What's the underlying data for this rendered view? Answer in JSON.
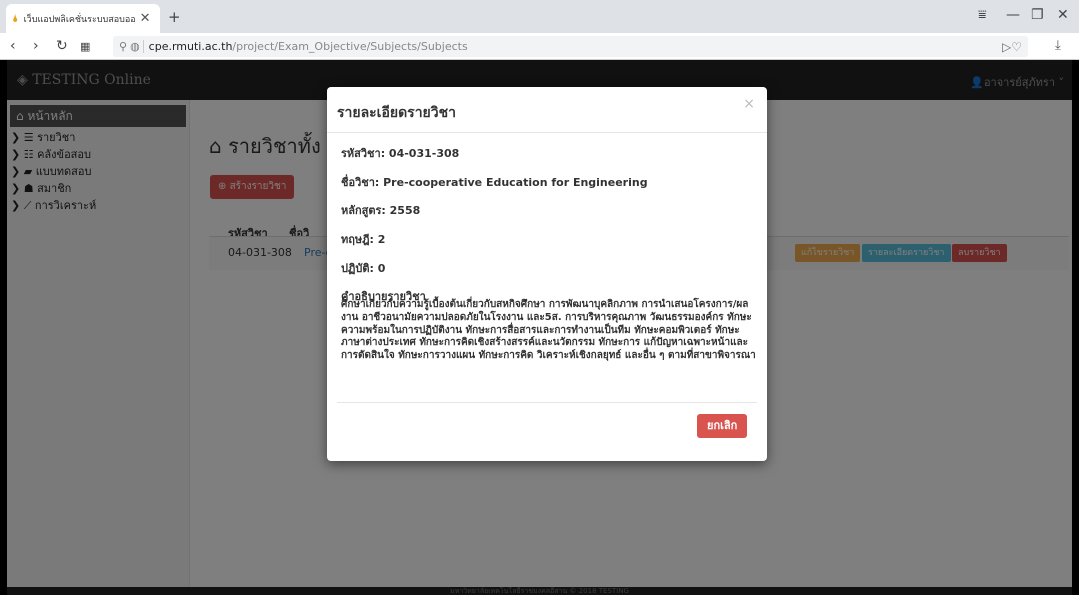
{
  "browser": {
    "tab_title": "เว็บแอปพลิเคชั่นระบบสอบออนไ",
    "tab_close": "✕",
    "new_tab": "+",
    "url_host": "cpe.rmuti.ac.th",
    "url_path": "/project/Exam_Objective/Subjects/Subjects"
  },
  "navbar": {
    "brand": "TESTING Online",
    "user": "อาจารย์สุภัทรา"
  },
  "sidebar": {
    "items": [
      {
        "label": "หน้าหลัก",
        "icon": "home-icon"
      },
      {
        "label": "รายวิชา",
        "icon": "list-icon"
      },
      {
        "label": "คลังข้อสอบ",
        "icon": "database-icon"
      },
      {
        "label": "แบบทดสอบ",
        "icon": "book-icon"
      },
      {
        "label": "สมาชิก",
        "icon": "users-icon"
      },
      {
        "label": "การวิเคราะห์",
        "icon": "chart-icon"
      }
    ]
  },
  "content": {
    "title": "รายวิชาทั้ง",
    "create_button": "สร้างรายวิชา",
    "columns": [
      "รหัสวิชา",
      "ชื่อวิ"
    ],
    "row": {
      "code": "04-031-308",
      "name": "Pre-c",
      "edit": "แก้ไขรายวิชา",
      "detail": "รายละเอียดรายวิชา",
      "delete": "ลบรายวิชา"
    }
  },
  "footer": "มหาวิทยาลัยเทคโนโลยีราชมงคลอีสาน © 2018 TESTING",
  "modal": {
    "title": "รายละเอียดรายวิชา",
    "close": "×",
    "code": "รหัสวิชา: 04-031-308",
    "name": "ชื่อวิชา: Pre-cooperative Education for Engineering",
    "curriculum": "หลักสูตร: 2558",
    "theory": "ทฤษฎี: 2",
    "practice": "ปฏิบัติ: 0",
    "desc_label": "คำอธิบายรายวิชา",
    "desc": "ศึกษาเกี่ยวกับความรู้เบื้องต้นเกี่ยวกับสหกิจศึกษา การพัฒนาบุคลิกภาพ การนำเสนอโครงการ/ผลงาน อาชีวอนามัยความปลอดภัยในโรงงาน และ5ส. การบริหารคุณภาพ วัฒนธรรมองค์กร ทักษะความพร้อมในการปฏิบัติงาน ทักษะการสื่อสารและการทำงานเป็นทีม ทักษะคอมพิวเตอร์ ทักษะ ภาษาต่างประเทศ ทักษะการคิดเชิงสร้างสรรค์และนวัตกรรม ทักษะการ แก้ปัญหาเฉพาะหน้าและการตัดสินใจ ทักษะการวางแผน ทักษะการคิด วิเคราะห์เชิงกลยุทธ์ และอื่น ๆ ตามที่สาขาพิจารณา",
    "cancel": "ยกเลิก"
  },
  "colors": {
    "danger": "#d9534f",
    "warning": "#f0ad4e",
    "info": "#5bc0de",
    "navbar": "#222222"
  }
}
